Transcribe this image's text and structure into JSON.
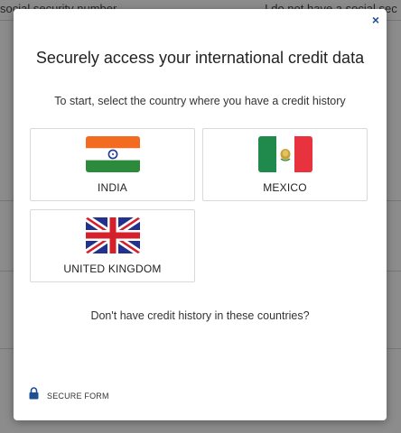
{
  "background": {
    "field_left": "social security number",
    "field_right": "I do not have a social sec"
  },
  "modal": {
    "close_label": "×",
    "title": "Securely access your international credit data",
    "subtitle": "To start, select the country where you have a credit history",
    "countries": [
      {
        "name": "INDIA",
        "flag": "india-flag"
      },
      {
        "name": "MEXICO",
        "flag": "mexico-flag"
      },
      {
        "name": "UNITED KINGDOM",
        "flag": "uk-flag"
      }
    ],
    "no_history_link": "Don't have credit history in these countries?",
    "secure_label": "SECURE FORM"
  },
  "colors": {
    "accent": "#1d4f91",
    "india_saffron": "#f26b21",
    "india_green": "#2c8a3c",
    "mexico_green": "#1f8a4c",
    "mexico_red": "#e8323e",
    "uk_blue": "#23318e",
    "uk_red": "#d4202a"
  }
}
